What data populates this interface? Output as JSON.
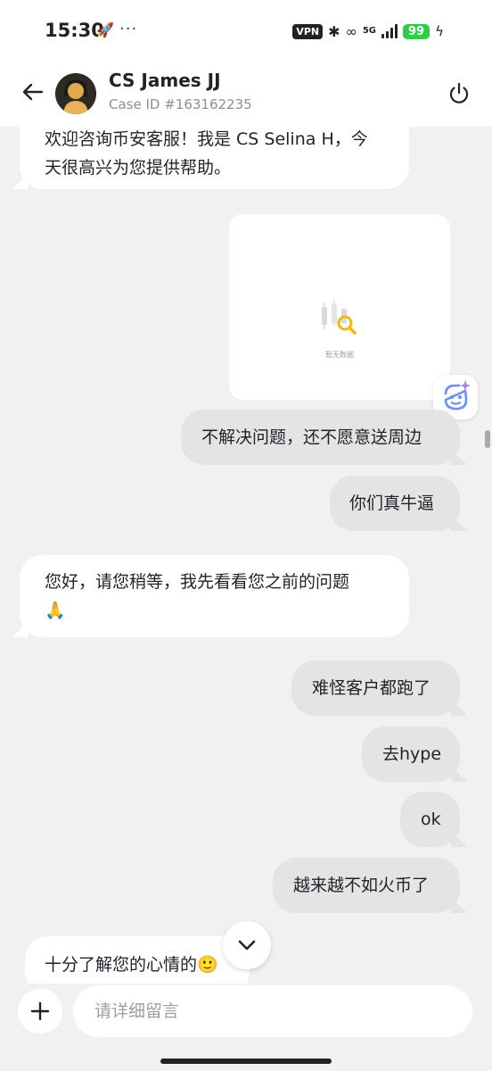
{
  "status_bar": {
    "time": "15:30",
    "dots": "···",
    "vpn": "VPN",
    "network": "5G",
    "battery": "99"
  },
  "header": {
    "agent_name": "CS James JJ",
    "case_id": "Case ID #163162235"
  },
  "messages": [
    {
      "from": "agent",
      "lines": [
        "欢迎咨询币安客服！我是 CS Selina H，今",
        "天很高兴为您提供帮助。"
      ]
    },
    {
      "from": "user",
      "type": "image",
      "empty_text": "暂无数据"
    },
    {
      "from": "user",
      "text": "不解决问题，还不愿意送周边"
    },
    {
      "from": "user",
      "text": "你们真牛逼"
    },
    {
      "from": "agent",
      "lines": [
        "您好，请您稍等，我先看看您之前的问题",
        "🙏"
      ]
    },
    {
      "from": "user",
      "text": "难怪客户都跑了"
    },
    {
      "from": "user",
      "text": "去hype"
    },
    {
      "from": "user",
      "text": "ok"
    },
    {
      "from": "user",
      "text": "越来越不如火币了"
    },
    {
      "from": "agent",
      "text": "十分了解您的心情的🙂"
    }
  ],
  "input": {
    "placeholder": "请详细留言"
  },
  "icons": {
    "back": "arrow-left-icon",
    "power": "power-icon",
    "add": "plus-icon",
    "scroll_down": "chevron-down-icon",
    "ai_assistant": "sparkle-face-icon"
  },
  "colors": {
    "background": "#f1f1f1",
    "incoming_bubble": "#ffffff",
    "outgoing_bubble": "#e4e4e4",
    "accent_yellow": "#f0b90b",
    "battery": "#2fcc46"
  }
}
